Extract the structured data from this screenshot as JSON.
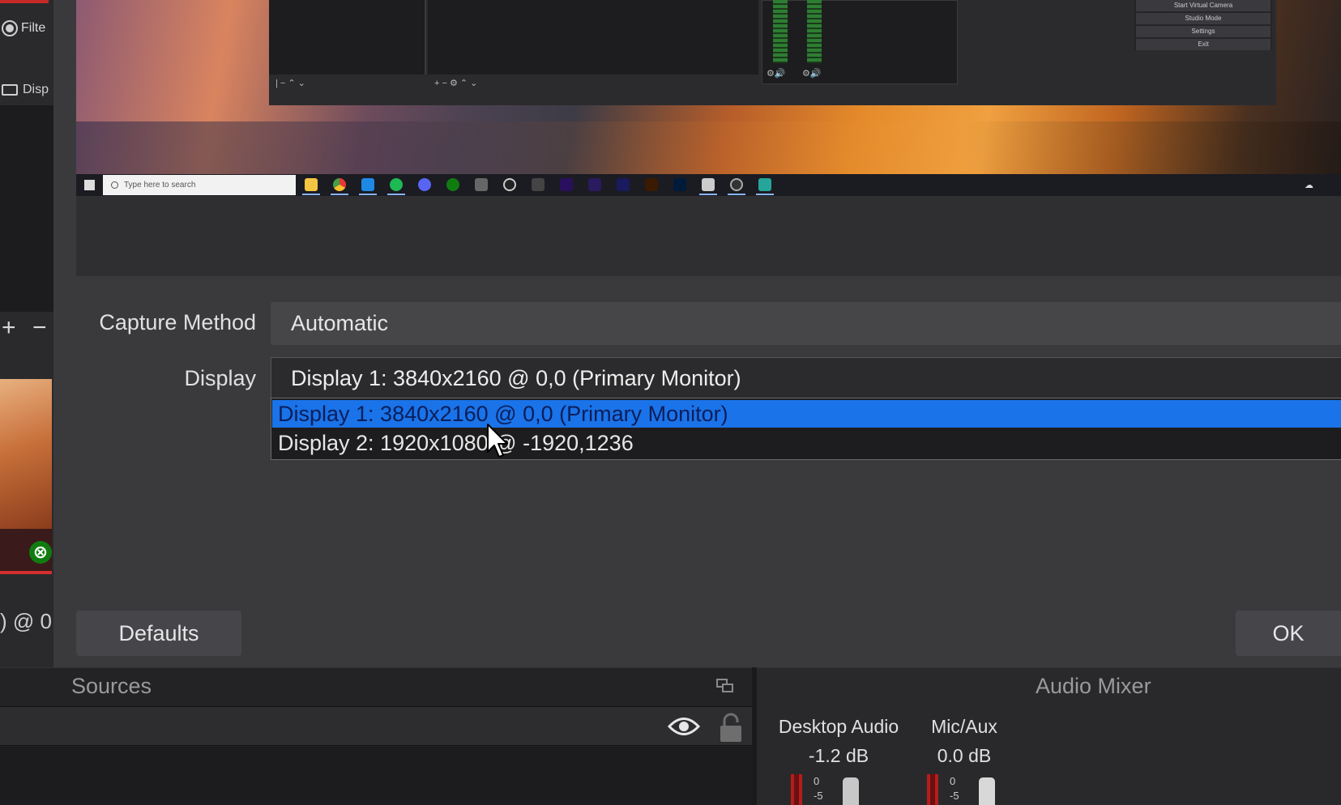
{
  "background_window": {
    "filters_label": "Filte",
    "source_item_label": "Disp",
    "add_glyph": "+",
    "remove_glyph": "−",
    "resolution_fragment": ") @ 0"
  },
  "preview": {
    "taskbar_search_placeholder": "Type here to search",
    "inner_controls": [
      "Start Virtual Camera",
      "Studio Mode",
      "Settings",
      "Exit"
    ]
  },
  "dialog": {
    "capture_method": {
      "label": "Capture Method",
      "value": "Automatic"
    },
    "display": {
      "label": "Display",
      "value": "Display 1: 3840x2160 @ 0,0 (Primary Monitor)",
      "options": [
        "Display 1: 3840x2160 @ 0,0 (Primary Monitor)",
        "Display 2: 1920x1080 @ -1920,1236"
      ],
      "highlighted_index": 0
    },
    "defaults_button": "Defaults",
    "ok_button": "OK"
  },
  "sources_dock": {
    "title": "Sources"
  },
  "audio_mixer": {
    "title": "Audio Mixer",
    "channels": [
      {
        "name": "Desktop Audio",
        "level": "-1.2 dB"
      },
      {
        "name": "Mic/Aux",
        "level": "0.0 dB"
      }
    ],
    "meter_ticks": [
      "0",
      "-5"
    ]
  },
  "colors": {
    "dialog_bg": "#3a3a3d",
    "highlight": "#1a73e8",
    "combo_bg": "#464649"
  }
}
